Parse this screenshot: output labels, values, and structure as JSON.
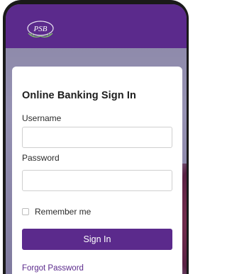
{
  "brand": {
    "logo_text": "PSB",
    "primary_color": "#5b2a8c"
  },
  "signin": {
    "title": "Online Banking Sign In",
    "username_label": "Username",
    "username_value": "",
    "password_label": "Password",
    "password_value": "",
    "remember_label": "Remember me",
    "remember_checked": false,
    "submit_label": "Sign In",
    "forgot_label": "Forgot Password"
  }
}
